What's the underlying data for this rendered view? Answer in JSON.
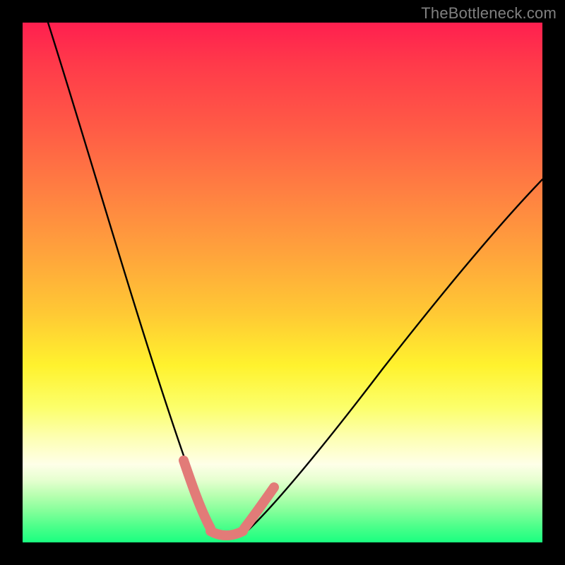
{
  "watermark": {
    "text": "TheBottleneck.com"
  },
  "chart_data": {
    "type": "line",
    "title": "",
    "xlabel": "",
    "ylabel": "",
    "xlim": [
      0,
      100
    ],
    "ylim": [
      0,
      100
    ],
    "grid": false,
    "legend": false,
    "series": [
      {
        "name": "bottleneck-curve",
        "x": [
          5,
          10,
          15,
          20,
          25,
          30,
          33,
          35,
          37,
          40,
          42,
          45,
          50,
          55,
          60,
          65,
          70,
          75,
          80,
          85,
          90,
          95,
          100
        ],
        "values": [
          100,
          80,
          62,
          46,
          32,
          18,
          10,
          4,
          2,
          2,
          2,
          4,
          9,
          15,
          22,
          29,
          36,
          42,
          48,
          54,
          60,
          65,
          70
        ]
      }
    ],
    "annotations": [
      {
        "name": "valley-marker-left",
        "x_range": [
          30,
          37
        ],
        "y_range": [
          3,
          13
        ],
        "color": "#e27b78"
      },
      {
        "name": "valley-marker-floor",
        "x_range": [
          35,
          42
        ],
        "y_range": [
          2,
          4
        ],
        "color": "#e27b78"
      },
      {
        "name": "valley-marker-right",
        "x_range": [
          42,
          47
        ],
        "y_range": [
          3,
          10
        ],
        "color": "#e27b78"
      }
    ],
    "background_gradient": {
      "stops": [
        {
          "pos": 0,
          "color": "#ff1f4f"
        },
        {
          "pos": 20,
          "color": "#ff5a46"
        },
        {
          "pos": 44,
          "color": "#ffa23c"
        },
        {
          "pos": 66,
          "color": "#fff22e"
        },
        {
          "pos": 85,
          "color": "#feffe8"
        },
        {
          "pos": 100,
          "color": "#1aff80"
        }
      ]
    }
  }
}
